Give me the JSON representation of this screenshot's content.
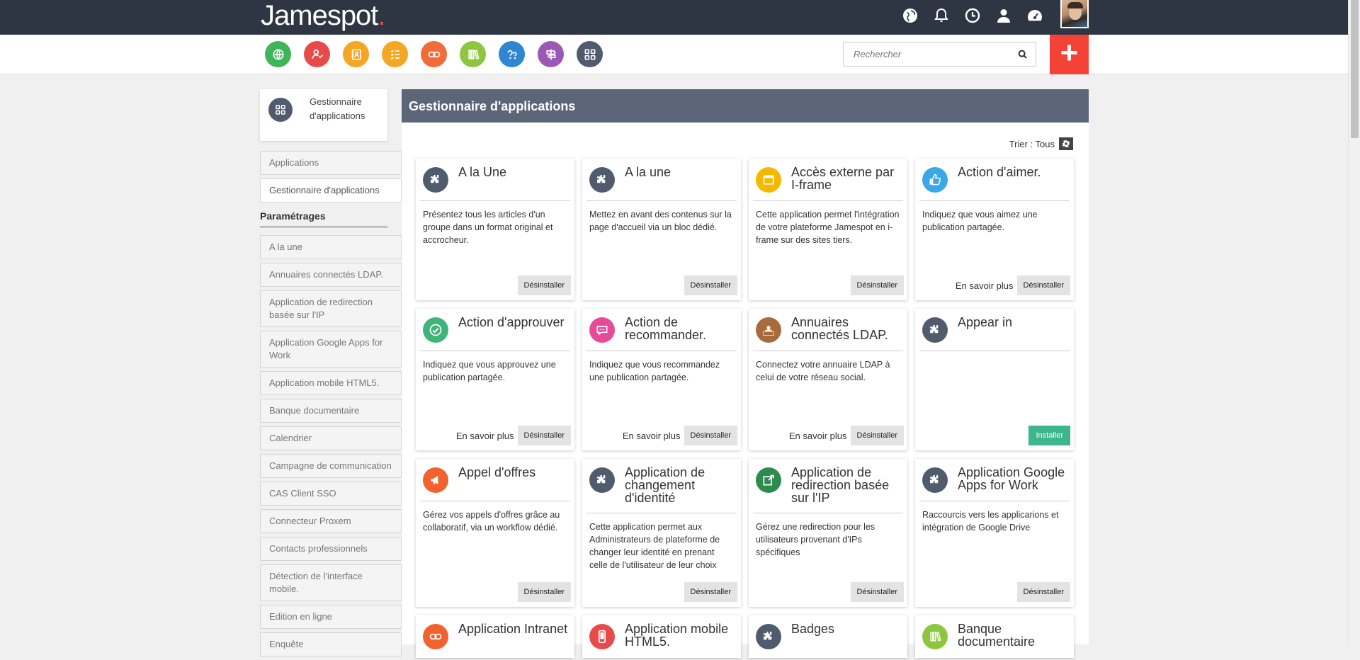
{
  "brand": {
    "name": "Jamespot",
    "dot": "."
  },
  "top_icons": [
    "globe-icon",
    "bell-icon",
    "clock-icon",
    "user-icon",
    "dashboard-icon"
  ],
  "app_icons": [
    {
      "name": "globe-app-icon",
      "color": "#3fb55a"
    },
    {
      "name": "contacts-app-icon",
      "color": "#e84a4a"
    },
    {
      "name": "directory-app-icon",
      "color": "#f5a623"
    },
    {
      "name": "tasks-app-icon",
      "color": "#f5a623"
    },
    {
      "name": "links-app-icon",
      "color": "#f26b3a"
    },
    {
      "name": "library-app-icon",
      "color": "#8dc63f"
    },
    {
      "name": "help-app-icon",
      "color": "#2f86d3"
    },
    {
      "name": "signpost-app-icon",
      "color": "#9b59b6"
    },
    {
      "name": "apps-grid-app-icon",
      "color": "#505c6e"
    }
  ],
  "search": {
    "placeholder": "Rechercher"
  },
  "add_button": {
    "label": "+"
  },
  "sidebar": {
    "header_title": "Gestionnaire d'applications",
    "nav": [
      {
        "label": "Applications",
        "active": false
      },
      {
        "label": "Gestionnaire d'applications",
        "active": true
      }
    ],
    "section_title": "Paramétrages",
    "items": [
      "A la une",
      "Annuaires connectés LDAP.",
      "Application de redirection basée sur l'IP",
      "Application Google Apps for Work",
      "Application mobile HTML5.",
      "Banque documentaire",
      "Calendrier",
      "Campagne de communication",
      "CAS Client SSO",
      "Connecteur Proxem",
      "Contacts professionnels",
      "Détection de l'interface mobile.",
      "Edition en ligne",
      "Enquête"
    ]
  },
  "main": {
    "title": "Gestionnaire d'applications",
    "sort_label": "Trier : Tous",
    "cards": [
      {
        "title": "A la Une",
        "icon": "puzzle-icon",
        "color": "#505c6e",
        "desc": "Présentez tous les articles d'un groupe dans un format original et accrocheur.",
        "more": "",
        "action": "Désinstaller",
        "installed": true
      },
      {
        "title": "A la une",
        "icon": "puzzle-icon",
        "color": "#505c6e",
        "desc": "Mettez en avant des contenus sur la page d'accueil via un bloc dédié.",
        "more": "",
        "action": "Désinstaller",
        "installed": true
      },
      {
        "title": "Accès externe par I-frame",
        "icon": "window-icon",
        "color": "#f5b800",
        "desc": "Cette application permet l'intégration de votre plateforme Jamespot en i-frame sur des sites tiers.",
        "more": "",
        "action": "Désinstaller",
        "installed": true
      },
      {
        "title": "Action d'aimer.",
        "icon": "thumbs-up-icon",
        "color": "#3aa8e8",
        "desc": "Indiquez que vous aimez une publication partagée.",
        "more": "En savoir plus",
        "action": "Désinstaller",
        "installed": true
      },
      {
        "title": "Action d'approuver",
        "icon": "check-icon",
        "color": "#3fb57a",
        "desc": "Indiquez que vous approuvez une publication partagée.",
        "more": "En savoir plus",
        "action": "Désinstaller",
        "installed": true
      },
      {
        "title": "Action de recommander.",
        "icon": "chat-bubble-icon",
        "color": "#e84a9a",
        "desc": "Indiquez que vous recommandez une publication partagée.",
        "more": "En savoir plus",
        "action": "Désinstaller",
        "installed": true
      },
      {
        "title": "Annuaires connectés LDAP.",
        "icon": "ldap-icon",
        "color": "#a86b3c",
        "desc": "Connectez votre annuaire LDAP à celui de votre réseau social.",
        "more": "En savoir plus",
        "action": "Désinstaller",
        "installed": true
      },
      {
        "title": "Appear in",
        "icon": "puzzle-icon",
        "color": "#505c6e",
        "desc": "",
        "more": "",
        "action": "Installer",
        "installed": false
      },
      {
        "title": "Appel d'offres",
        "icon": "megaphone-icon",
        "color": "#f2622e",
        "desc": "Gérez vos appels d'offres grâce au collaboratif, via un workflow dédié.",
        "more": "",
        "action": "Désinstaller",
        "installed": true
      },
      {
        "title": "Application de changement d'identité",
        "icon": "puzzle-icon",
        "color": "#505c6e",
        "desc": "Cette application permet aux Administrateurs de plateforme de changer leur identité en prenant celle de l'utilisateur de leur choix",
        "more": "",
        "action": "Désinstaller",
        "installed": true
      },
      {
        "title": "Application de redirection basée sur l'IP",
        "icon": "redirect-icon",
        "color": "#2e8b4e",
        "desc": "Gérez une redirection pour les utilisateurs provenant d'IPs spécifiques",
        "more": "",
        "action": "Désinstaller",
        "installed": true
      },
      {
        "title": "Application Google Apps for Work",
        "icon": "puzzle-icon",
        "color": "#505c6e",
        "desc": "Raccourcis vers les applicarions et intégration de Google Drive",
        "more": "",
        "action": "Désinstaller",
        "installed": true
      },
      {
        "title": "Application Intranet",
        "icon": "link-icon",
        "color": "#f2622e",
        "desc": "",
        "more": "",
        "action": "",
        "installed": true
      },
      {
        "title": "Application mobile HTML5.",
        "icon": "mobile-icon",
        "color": "#e84a4a",
        "desc": "",
        "more": "",
        "action": "",
        "installed": true
      },
      {
        "title": "Badges",
        "icon": "puzzle-icon",
        "color": "#505c6e",
        "desc": "",
        "more": "",
        "action": "",
        "installed": true
      },
      {
        "title": "Banque documentaire",
        "icon": "books-icon",
        "color": "#8dc63f",
        "desc": "",
        "more": "",
        "action": "",
        "installed": true
      }
    ]
  }
}
